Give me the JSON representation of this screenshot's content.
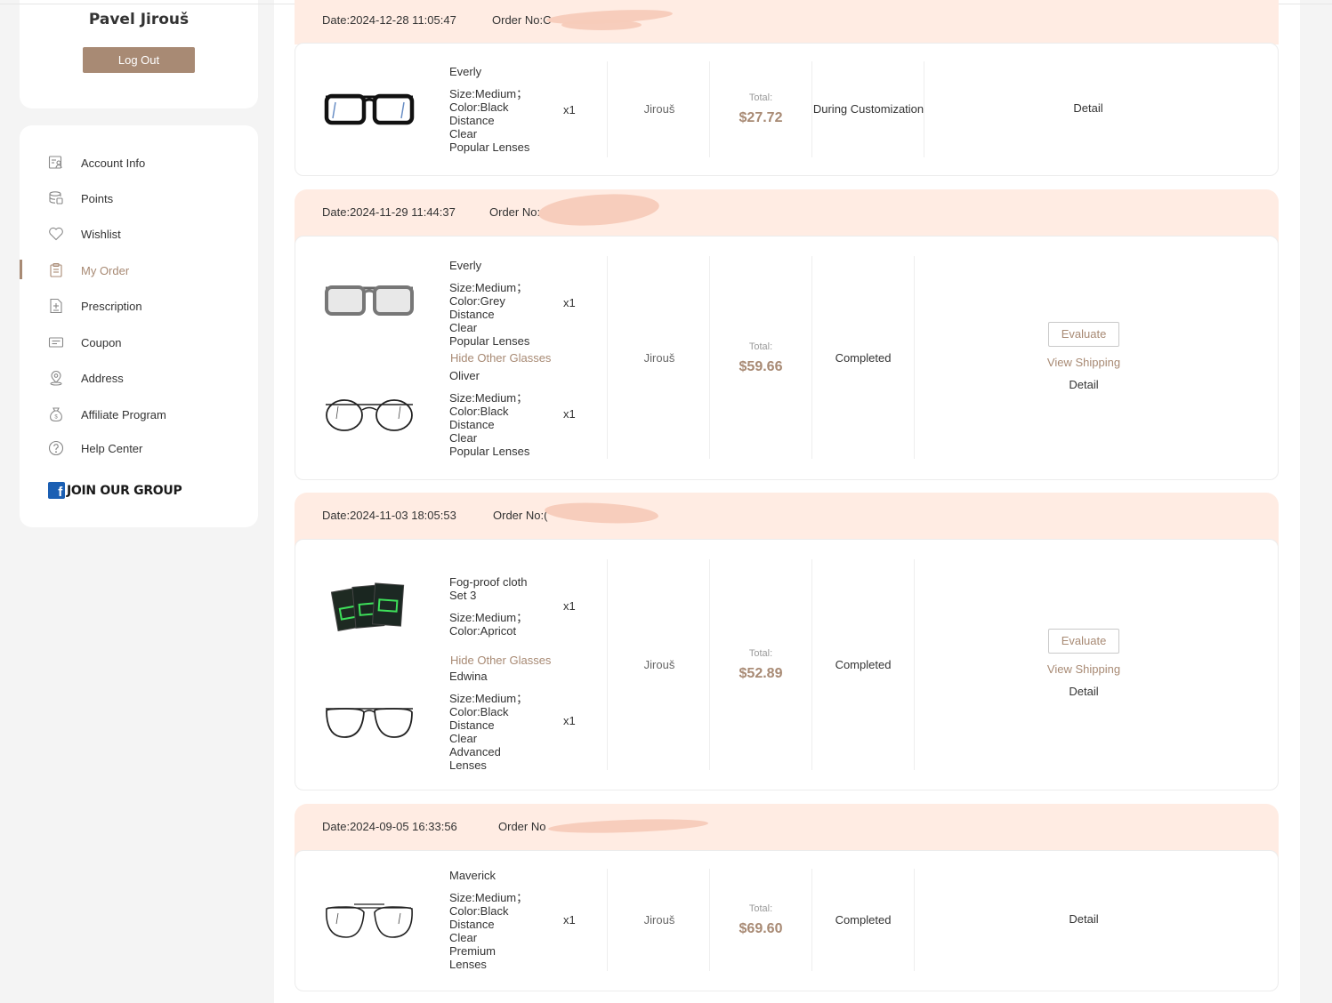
{
  "user": {
    "name": "Pavel Jirouš",
    "logout_label": "Log Out"
  },
  "menu": [
    {
      "label": "Account Info",
      "icon": "account-info-icon"
    },
    {
      "label": "Points",
      "icon": "points-icon"
    },
    {
      "label": "Wishlist",
      "icon": "heart-icon"
    },
    {
      "label": "My Order",
      "icon": "order-icon",
      "active": true
    },
    {
      "label": "Prescription",
      "icon": "prescription-icon"
    },
    {
      "label": "Coupon",
      "icon": "coupon-icon"
    },
    {
      "label": "Address",
      "icon": "location-icon"
    },
    {
      "label": "Affiliate Program",
      "icon": "money-bag-icon"
    },
    {
      "label": "Help Center",
      "icon": "help-icon"
    }
  ],
  "join_group": "JOIN OUR GROUP",
  "colors": {
    "accent": "#a88a74",
    "header_bg": "#ffece3"
  },
  "labels": {
    "total": "Total:",
    "detail": "Detail",
    "evaluate": "Evaluate",
    "view_shipping": "View Shipping",
    "hide_other": "Hide Other Glasses"
  },
  "orders": [
    {
      "date": "Date:2024-12-28 11:05:47",
      "order_no": "Order No:C",
      "buyer": "Jirouš",
      "total": "$27.72",
      "status": "During Customization",
      "items": [
        {
          "name": "Everly",
          "spec": [
            "Size:Medium；",
            "Color:Black",
            "Distance",
            "Clear",
            "Popular Lenses"
          ],
          "qty": "x1"
        }
      ]
    },
    {
      "date": "Date:2024-11-29 11:44:37",
      "order_no": "Order No:",
      "buyer": "Jirouš",
      "total": "$59.66",
      "status": "Completed",
      "items": [
        {
          "name": "Everly",
          "spec": [
            "Size:Medium；",
            "Color:Grey",
            "Distance",
            "Clear",
            "Popular Lenses"
          ],
          "qty": "x1"
        },
        {
          "name": "Oliver",
          "spec": [
            "Size:Medium；",
            "Color:Black",
            "Distance",
            "Clear",
            "Popular Lenses"
          ],
          "qty": "x1"
        }
      ]
    },
    {
      "date": "Date:2024-11-03 18:05:53",
      "order_no": "Order No:(",
      "buyer": "Jirouš",
      "total": "$52.89",
      "status": "Completed",
      "items": [
        {
          "name": "Fog-proof cloth Set 3",
          "spec": [
            "Size:Medium；",
            "Color:Apricot"
          ],
          "qty": "x1"
        },
        {
          "name": "Edwina",
          "spec": [
            "Size:Medium；",
            "Color:Black",
            "Distance",
            "Clear",
            "Advanced",
            "Lenses"
          ],
          "qty": "x1"
        }
      ]
    },
    {
      "date": "Date:2024-09-05 16:33:56",
      "order_no": "Order No",
      "buyer": "Jirouš",
      "total": "$69.60",
      "status": "Completed",
      "items": [
        {
          "name": "Maverick",
          "spec": [
            "Size:Medium；",
            "Color:Black",
            "Distance",
            "Clear",
            "Premium",
            "Lenses"
          ],
          "qty": "x1"
        }
      ]
    }
  ]
}
